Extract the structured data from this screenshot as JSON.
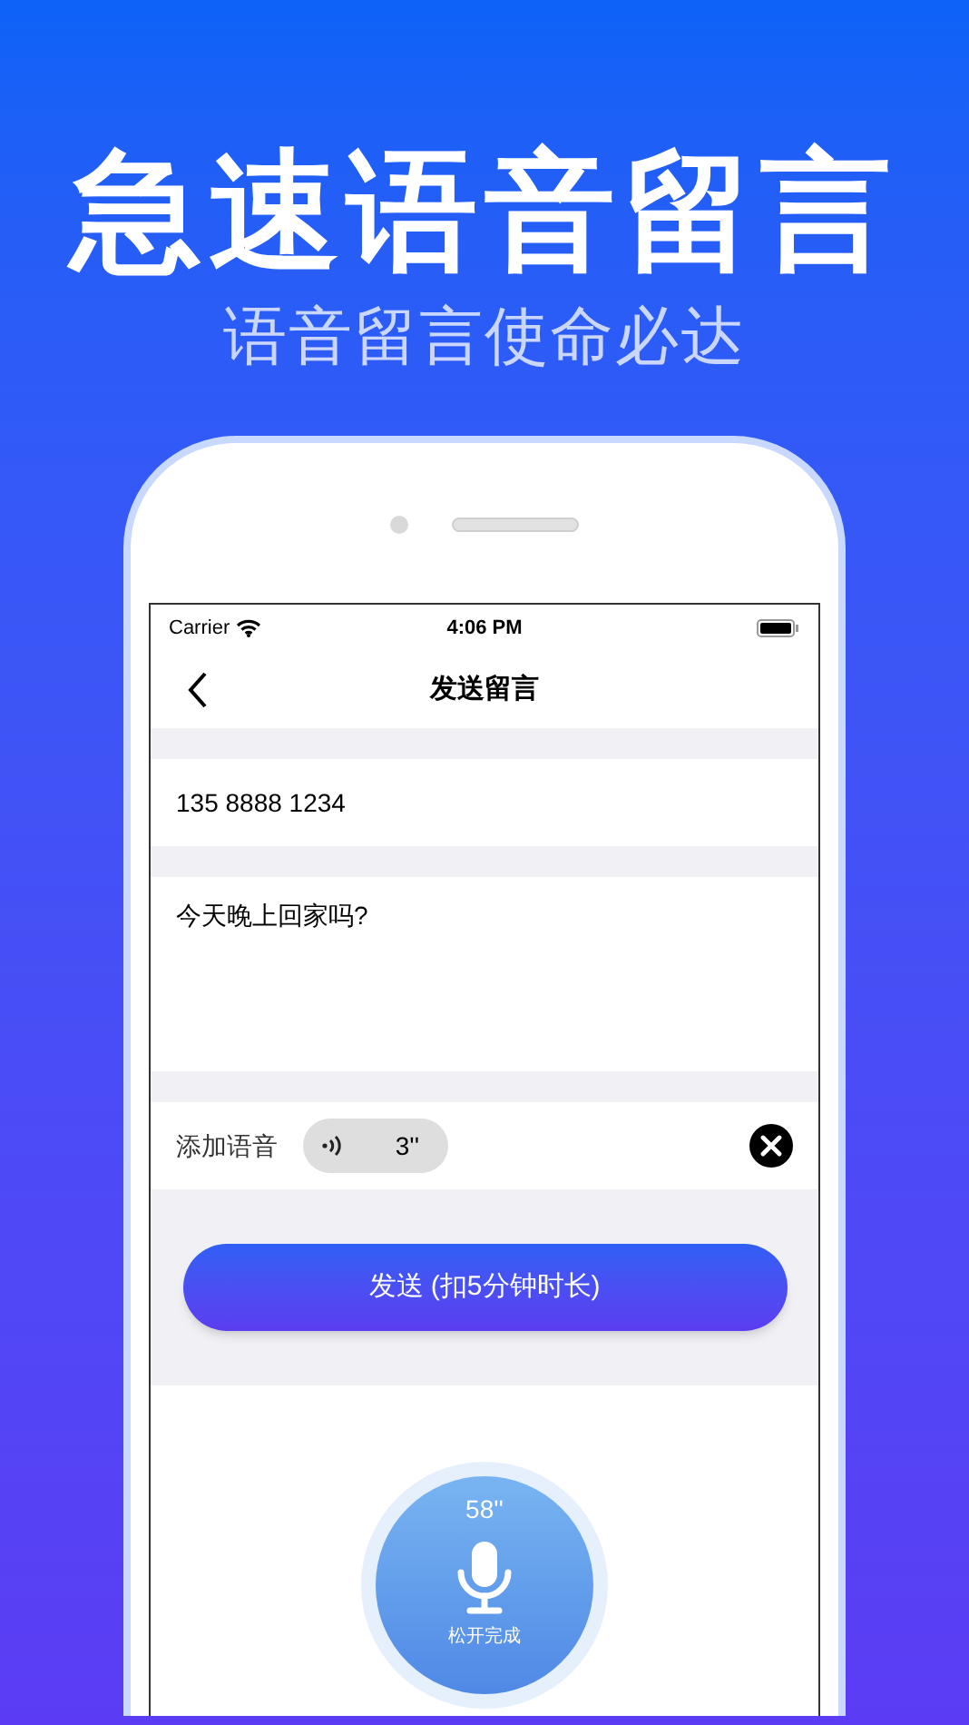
{
  "headline": "急速语音留言",
  "subtitle": "语音留言使命必达",
  "status_bar": {
    "carrier": "Carrier",
    "time": "4:06 PM"
  },
  "nav": {
    "title": "发送留言"
  },
  "form": {
    "phone": "135 8888 1234",
    "message": "今天晚上回家吗?",
    "voice_label": "添加语音",
    "voice_duration": "3''"
  },
  "send_button": "发送 (扣5分钟时长)",
  "recorder": {
    "timer": "58''",
    "hint": "松开完成"
  }
}
